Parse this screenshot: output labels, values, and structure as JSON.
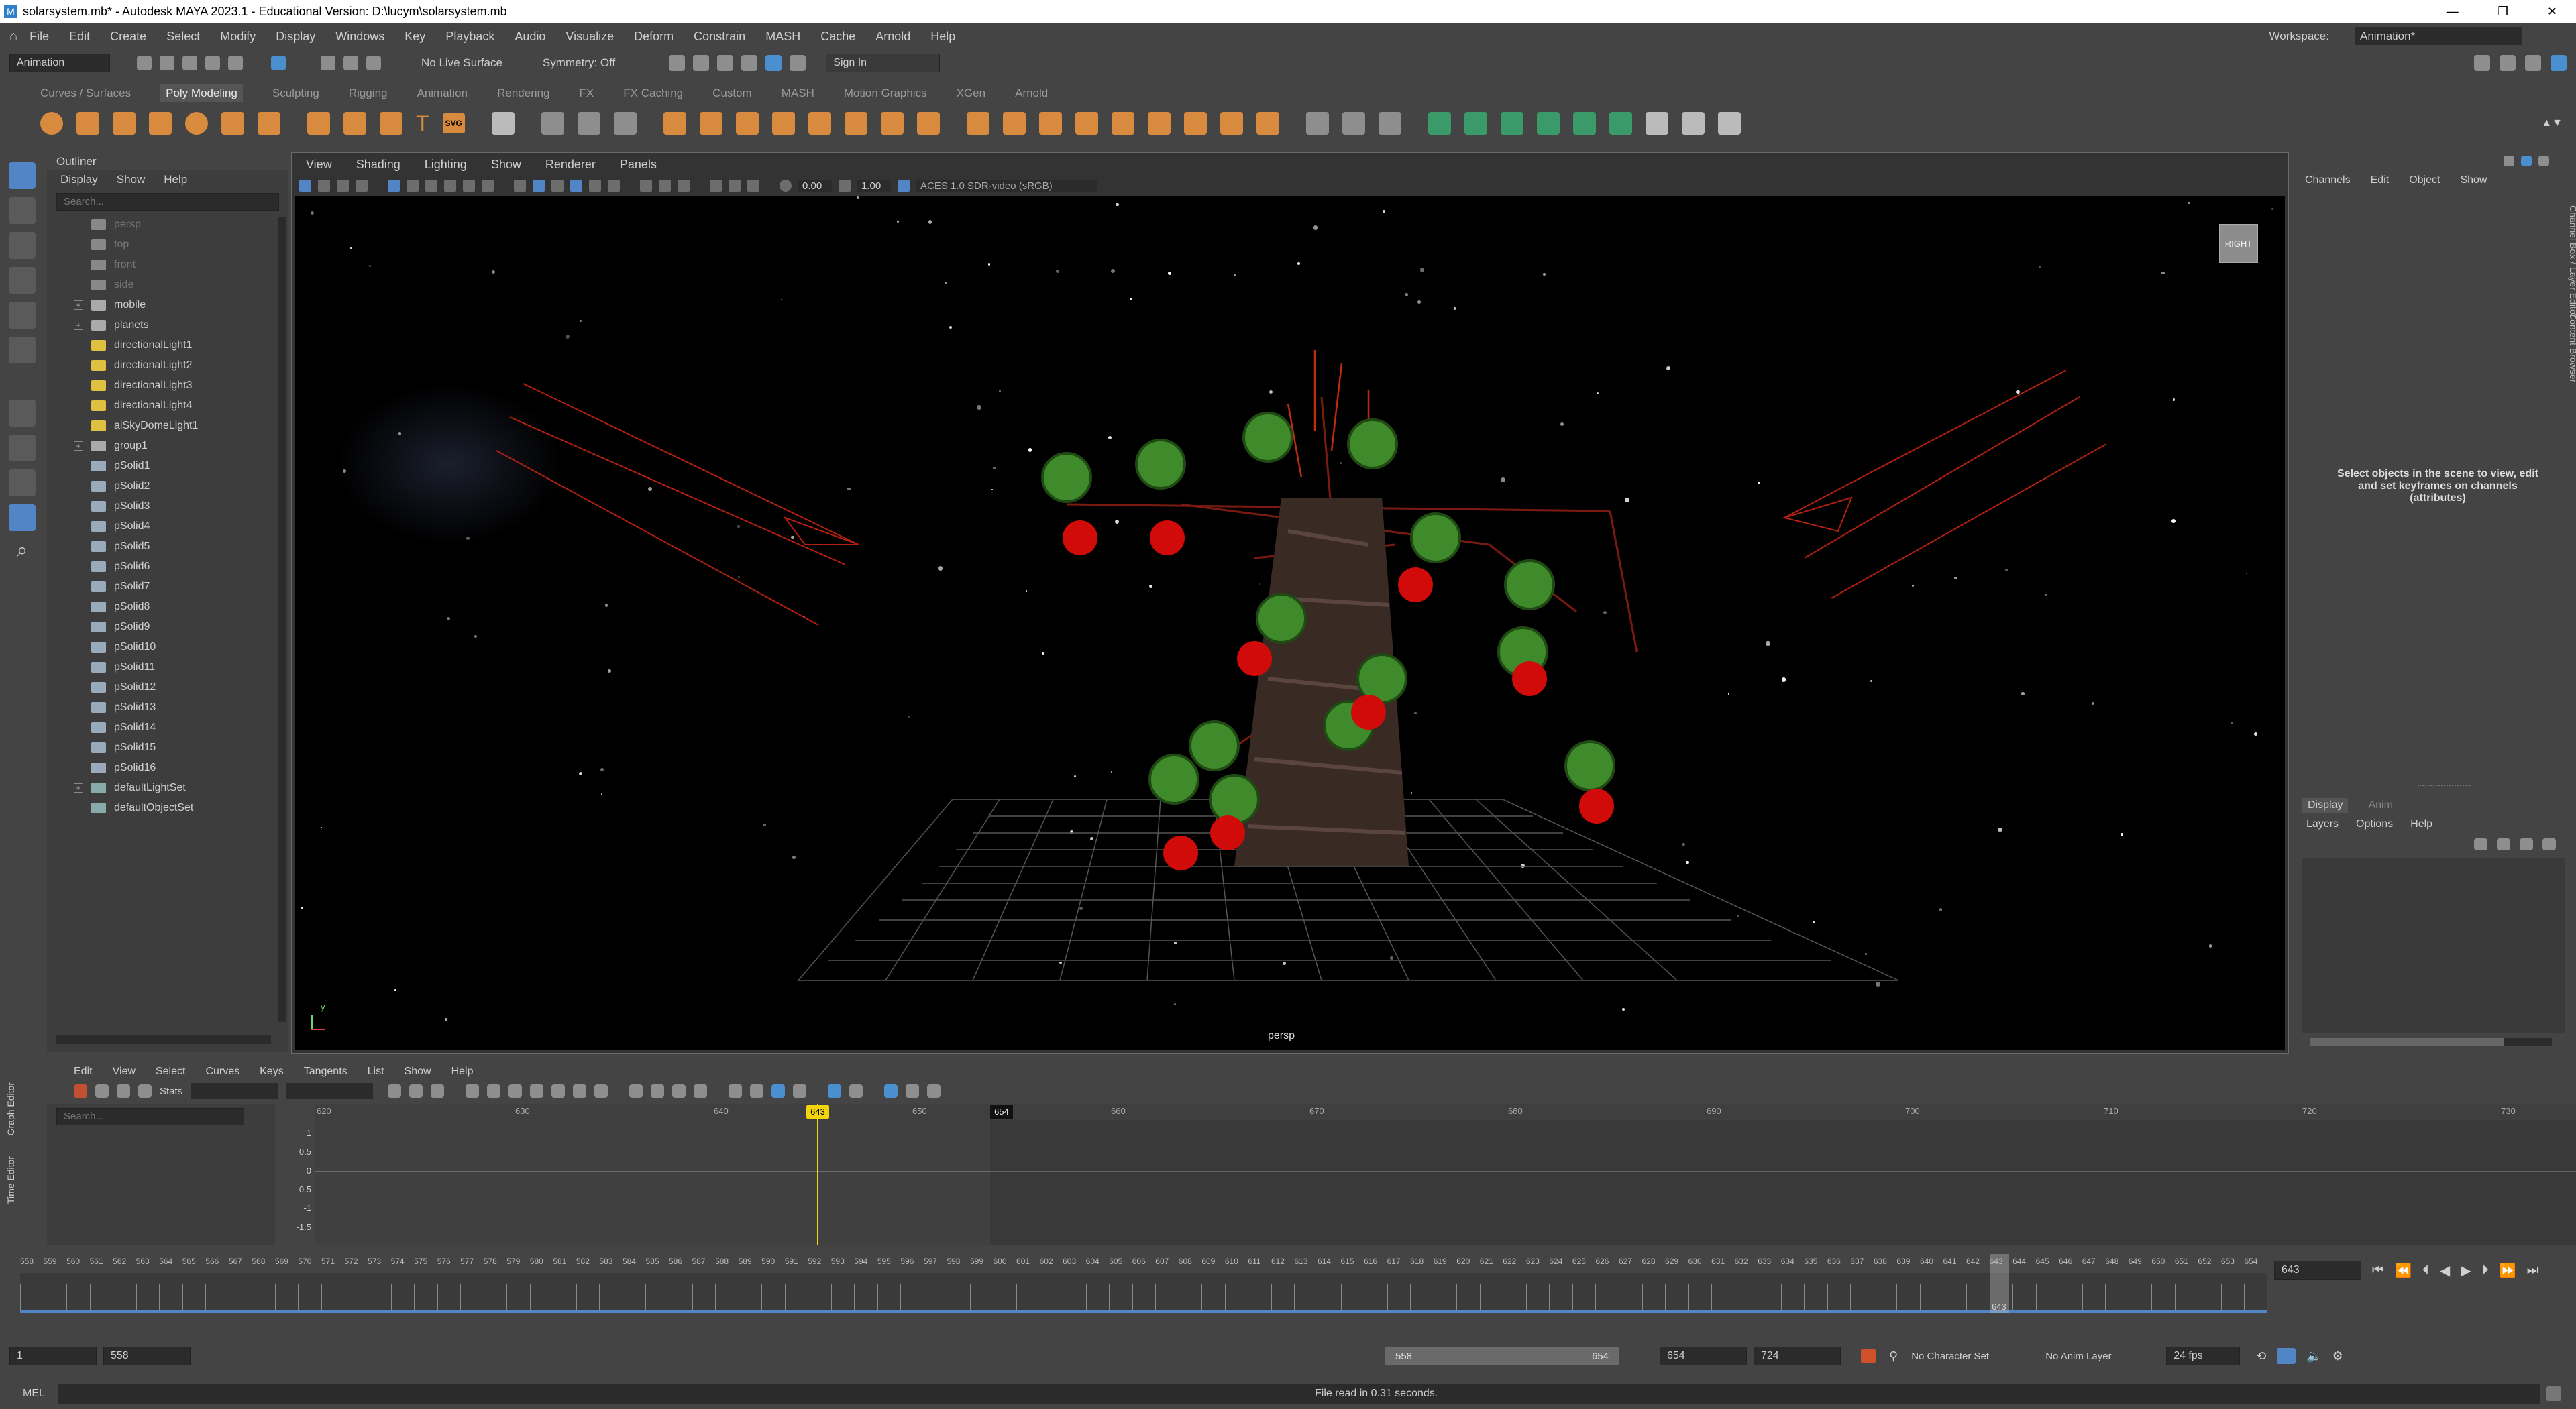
{
  "window": {
    "title": "solarsystem.mb* - Autodesk MAYA 2023.1 - Educational Version: D:\\lucym\\solarsystem.mb",
    "controls": [
      "—",
      "❐",
      "✕"
    ]
  },
  "menubar": {
    "items": [
      "File",
      "Edit",
      "Create",
      "Select",
      "Modify",
      "Display",
      "Windows",
      "Key",
      "Playback",
      "Audio",
      "Visualize",
      "Deform",
      "Constrain",
      "MASH",
      "Cache",
      "Arnold",
      "Help"
    ],
    "workspace_label": "Workspace:",
    "workspace_value": "Animation*"
  },
  "statusline": {
    "menu_set": "Animation",
    "live_surface": "No Live Surface",
    "symmetry": "Symmetry: Off",
    "sign_in": "Sign In"
  },
  "shelf": {
    "tabs": [
      "Curves / Surfaces",
      "Poly Modeling",
      "Sculpting",
      "Rigging",
      "Animation",
      "Rendering",
      "FX",
      "FX Caching",
      "Custom",
      "MASH",
      "Motion Graphics",
      "XGen",
      "Arnold"
    ],
    "active_tab": "Poly Modeling",
    "text_tool": "T",
    "svg_tool": "SVG"
  },
  "outliner": {
    "title": "Outliner",
    "menu": [
      "Display",
      "Show",
      "Help"
    ],
    "search_placeholder": "Search...",
    "items": [
      {
        "name": "persp",
        "dim": true,
        "expand": false,
        "icon": "camera"
      },
      {
        "name": "top",
        "dim": true,
        "expand": false,
        "icon": "camera"
      },
      {
        "name": "front",
        "dim": true,
        "expand": false,
        "icon": "camera"
      },
      {
        "name": "side",
        "dim": true,
        "expand": false,
        "icon": "camera"
      },
      {
        "name": "mobile",
        "dim": false,
        "expand": true,
        "icon": "group"
      },
      {
        "name": "planets",
        "dim": false,
        "expand": true,
        "icon": "group"
      },
      {
        "name": "directionalLight1",
        "dim": false,
        "expand": false,
        "icon": "light"
      },
      {
        "name": "directionalLight2",
        "dim": false,
        "expand": false,
        "icon": "light"
      },
      {
        "name": "directionalLight3",
        "dim": false,
        "expand": false,
        "icon": "light"
      },
      {
        "name": "directionalLight4",
        "dim": false,
        "expand": false,
        "icon": "light"
      },
      {
        "name": "aiSkyDomeLight1",
        "dim": false,
        "expand": false,
        "icon": "light"
      },
      {
        "name": "group1",
        "dim": false,
        "expand": true,
        "icon": "group"
      },
      {
        "name": "pSolid1",
        "dim": false,
        "expand": false,
        "icon": "mesh"
      },
      {
        "name": "pSolid2",
        "dim": false,
        "expand": false,
        "icon": "mesh"
      },
      {
        "name": "pSolid3",
        "dim": false,
        "expand": false,
        "icon": "mesh"
      },
      {
        "name": "pSolid4",
        "dim": false,
        "expand": false,
        "icon": "mesh"
      },
      {
        "name": "pSolid5",
        "dim": false,
        "expand": false,
        "icon": "mesh"
      },
      {
        "name": "pSolid6",
        "dim": false,
        "expand": false,
        "icon": "mesh"
      },
      {
        "name": "pSolid7",
        "dim": false,
        "expand": false,
        "icon": "mesh"
      },
      {
        "name": "pSolid8",
        "dim": false,
        "expand": false,
        "icon": "mesh"
      },
      {
        "name": "pSolid9",
        "dim": false,
        "expand": false,
        "icon": "mesh"
      },
      {
        "name": "pSolid10",
        "dim": false,
        "expand": false,
        "icon": "mesh"
      },
      {
        "name": "pSolid11",
        "dim": false,
        "expand": false,
        "icon": "mesh"
      },
      {
        "name": "pSolid12",
        "dim": false,
        "expand": false,
        "icon": "mesh"
      },
      {
        "name": "pSolid13",
        "dim": false,
        "expand": false,
        "icon": "mesh"
      },
      {
        "name": "pSolid14",
        "dim": false,
        "expand": false,
        "icon": "mesh"
      },
      {
        "name": "pSolid15",
        "dim": false,
        "expand": false,
        "icon": "mesh"
      },
      {
        "name": "pSolid16",
        "dim": false,
        "expand": false,
        "icon": "mesh"
      },
      {
        "name": "defaultLightSet",
        "dim": false,
        "expand": true,
        "icon": "set"
      },
      {
        "name": "defaultObjectSet",
        "dim": false,
        "expand": false,
        "icon": "set"
      }
    ]
  },
  "viewport": {
    "menu": [
      "View",
      "Shading",
      "Lighting",
      "Show",
      "Renderer",
      "Panels"
    ],
    "gamma": "0.00",
    "exposure": "1.00",
    "color_space": "ACES 1.0 SDR-video (sRGB)",
    "view_cube": "RIGHT",
    "camera_label": "persp",
    "axis_y": "y",
    "axis_x": "x"
  },
  "channel_box": {
    "menu": [
      "Channels",
      "Edit",
      "Object",
      "Show"
    ],
    "message": "Select objects in the scene to view, edit and set keyframes on channels (attributes)",
    "side_tabs": [
      "Channel Box / Layer Editor",
      "Content Browser"
    ],
    "layer_tabs": [
      "Display",
      "Anim"
    ],
    "layer_menu": [
      "Layers",
      "Options",
      "Help"
    ]
  },
  "graph_editor": {
    "side_labels": [
      "Graph Editor",
      "Time Editor"
    ],
    "menu": [
      "Edit",
      "View",
      "Select",
      "Curves",
      "Keys",
      "Tangents",
      "List",
      "Show",
      "Help"
    ],
    "stats_label": "Stats",
    "search_placeholder": "Search...",
    "ruler": [
      "620",
      "630",
      "640",
      "650",
      "660",
      "670",
      "680",
      "690",
      "700",
      "710",
      "720",
      "730"
    ],
    "current_frame": "643",
    "end_marker": "654",
    "y_ticks": [
      "1",
      "0.5",
      "0",
      "-0.5",
      "-1",
      "-1.5"
    ]
  },
  "timeline": {
    "start_tick": 558,
    "end_tick": 654,
    "current_frame": "643",
    "frame_field": "643"
  },
  "range": {
    "start": "1",
    "playback_start": "558",
    "slider_start": "558",
    "slider_end": "654",
    "playback_end": "654",
    "end": "724",
    "character_set": "No Character Set",
    "anim_layer": "No Anim Layer",
    "fps": "24 fps"
  },
  "command": {
    "lang": "MEL",
    "status": "File read in  0.31 seconds."
  },
  "colors": {
    "bg": "#444444",
    "accent_blue": "#5285c6",
    "playhead": "#f2d40d",
    "apple_red": "#d10a0a",
    "foliage_green": "#3f8a2a",
    "light_red": "#b32010"
  }
}
